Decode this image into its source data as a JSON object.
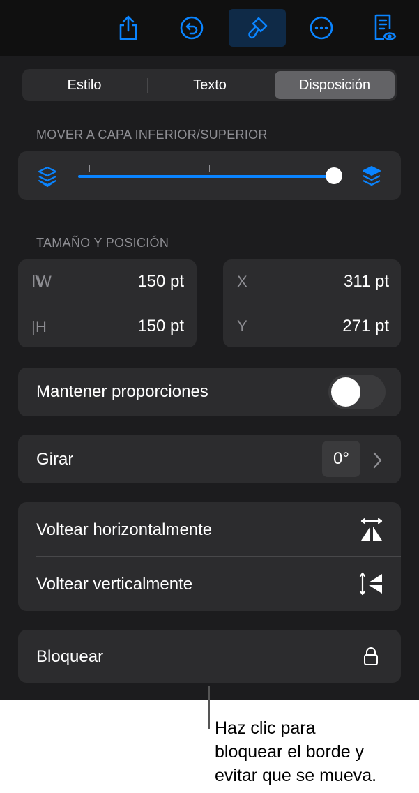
{
  "toolbar": {
    "buttons": [
      {
        "icon": "share-icon"
      },
      {
        "icon": "undo-icon"
      },
      {
        "icon": "format-brush-icon",
        "active": true
      },
      {
        "icon": "more-icon"
      },
      {
        "icon": "reader-view-icon"
      }
    ],
    "accent": "#0a84ff"
  },
  "tabs": {
    "items": [
      "Estilo",
      "Texto",
      "Disposición"
    ],
    "selected": "Disposición"
  },
  "arrange": {
    "title": "MOVER A CAPA INFERIOR/SUPERIOR",
    "slider_value": 1.0,
    "left_icon": "layers-back-icon",
    "right_icon": "layers-front-icon"
  },
  "size_position": {
    "title": "TAMAÑO Y POSICIÓN",
    "width_label": "W",
    "width_value": "150 pt",
    "height_label": "H",
    "height_value": "150 pt",
    "x_label": "X",
    "x_value": "311 pt",
    "y_label": "Y",
    "y_value": "271 pt"
  },
  "constrain": {
    "label": "Mantener proporciones",
    "on": false
  },
  "rotate": {
    "label": "Girar",
    "value": "0°"
  },
  "flip": {
    "horizontal_label": "Voltear horizontalmente",
    "vertical_label": "Voltear verticalmente"
  },
  "lock": {
    "label": "Bloquear"
  },
  "callout": {
    "text": "Haz clic para\nbloquear el borde y\nevitar que se mueva."
  }
}
